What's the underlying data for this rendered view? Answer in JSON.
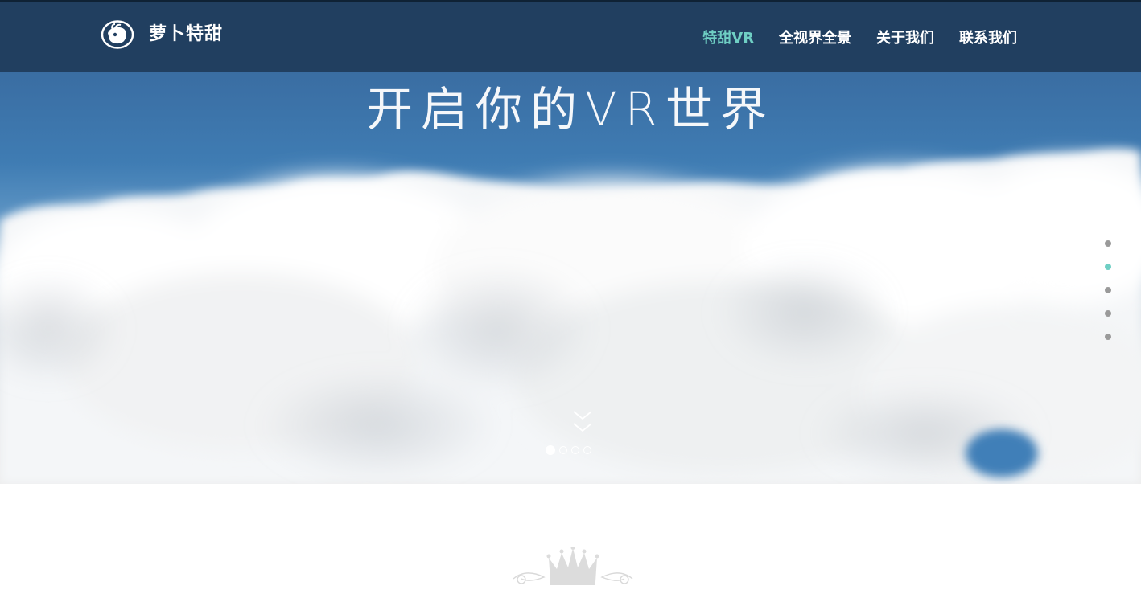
{
  "header": {
    "logo_text": "萝卜特甜",
    "logo_icon": "radish-logo-icon"
  },
  "nav": {
    "items": [
      {
        "label": "特甜VR",
        "active": true
      },
      {
        "label": "全视界全景",
        "active": false
      },
      {
        "label": "关于我们",
        "active": false
      },
      {
        "label": "联系我们",
        "active": false
      }
    ]
  },
  "hero": {
    "title": "开启你的VR世界",
    "scroll_icon": "double-chevron-down-icon",
    "carousel": {
      "count": 4,
      "active_index": 0
    }
  },
  "side_nav": {
    "count": 5,
    "active_index": 1
  },
  "ornament": {
    "icon": "crown-ornament-icon"
  },
  "colors": {
    "header_bg": "#213f60",
    "accent": "#6fcfc4",
    "sky_top": "#3a6da2",
    "side_dot": "#9a9a9a"
  }
}
